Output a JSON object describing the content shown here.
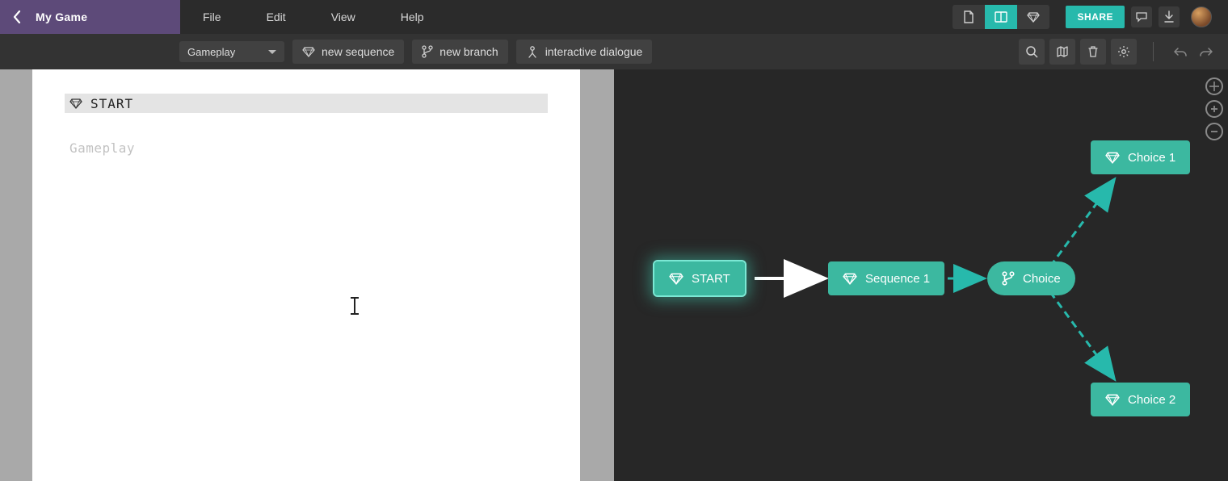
{
  "header": {
    "title": "My Game",
    "menus": [
      "File",
      "Edit",
      "View",
      "Help"
    ],
    "share_label": "SHARE"
  },
  "toolbar": {
    "dropdown_value": "Gameplay",
    "new_sequence": "new sequence",
    "new_branch": "new branch",
    "interactive_dialogue": "interactive dialogue"
  },
  "editor": {
    "start_label": "START",
    "placeholder": "Gameplay"
  },
  "graph": {
    "nodes": {
      "start": "START",
      "sequence1": "Sequence 1",
      "choice": "Choice",
      "choice1": "Choice 1",
      "choice2": "Choice 2"
    }
  },
  "colors": {
    "accent": "#27b9ac",
    "purple": "#5d4a79",
    "node": "#3cb8a0"
  }
}
